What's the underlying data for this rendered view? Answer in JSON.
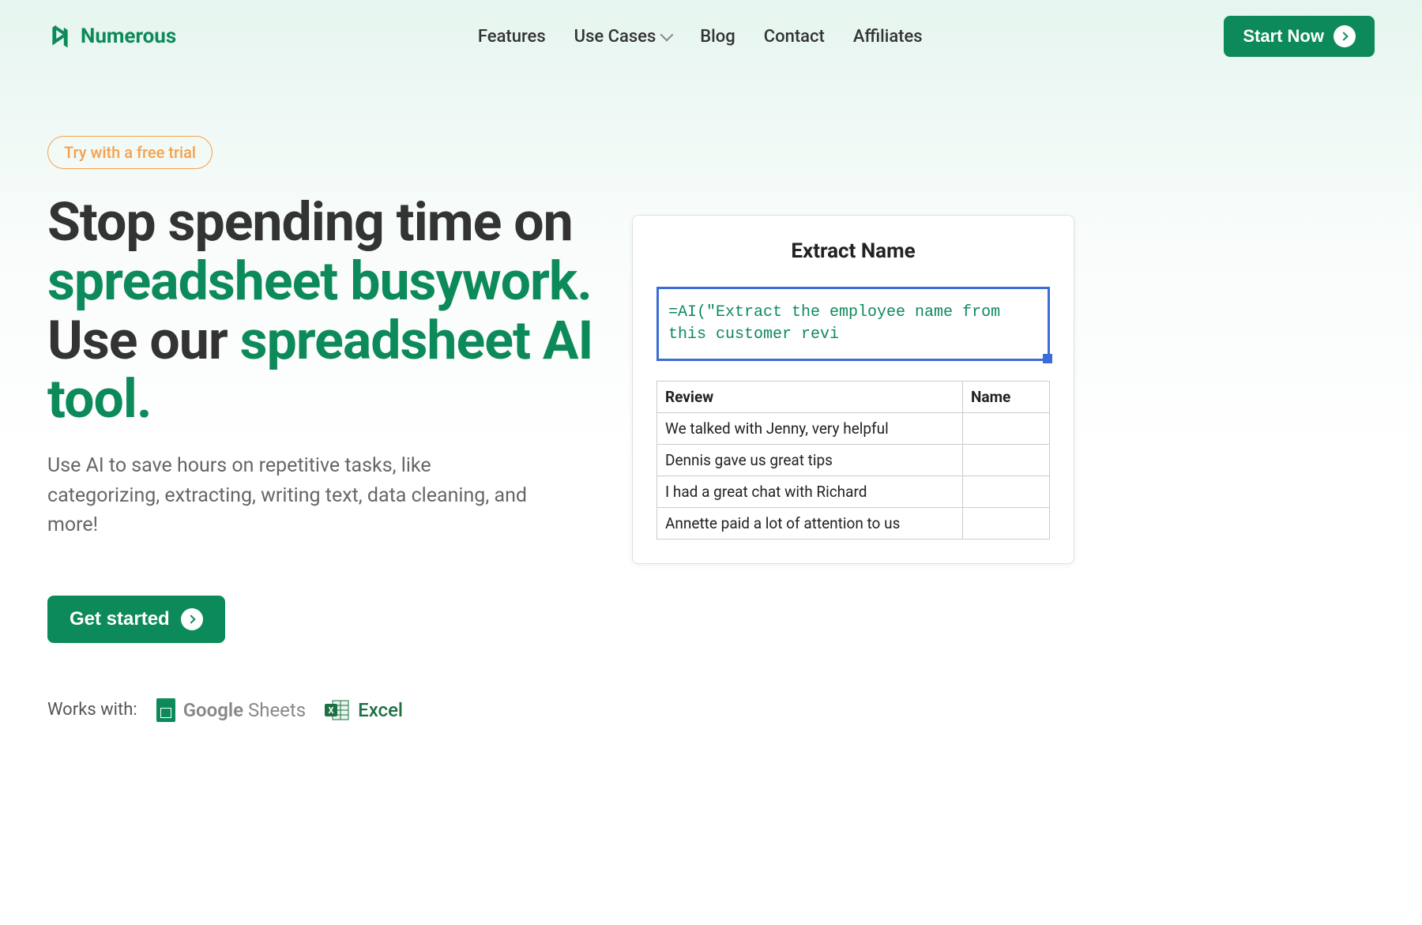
{
  "header": {
    "brand": "Numerous",
    "nav": {
      "features": "Features",
      "usecases": "Use Cases",
      "blog": "Blog",
      "contact": "Contact",
      "affiliates": "Affiliates"
    },
    "cta": "Start Now"
  },
  "hero": {
    "trial_badge": "Try with a free trial",
    "headline_part1": "Stop spending time on ",
    "headline_green1": "spreadsheet busywork. ",
    "headline_part2": "Use our ",
    "headline_green2": "spreadsheet AI tool.",
    "subheadline": "Use AI to save hours on repetitive tasks, like categorizing, extracting, writing text, data cleaning, and more!",
    "get_started": "Get started",
    "works_with_label": "Works with:",
    "partners": {
      "google_sheets_1": "Google",
      "google_sheets_2": " Sheets",
      "excel": "Excel"
    }
  },
  "demo": {
    "title": "Extract Name",
    "formula": "=AI(\"Extract the employee name from this customer revi",
    "table": {
      "headers": {
        "review": "Review",
        "name": "Name"
      },
      "rows": [
        {
          "review": "We talked with Jenny, very helpful",
          "name": ""
        },
        {
          "review": "Dennis gave us great tips",
          "name": ""
        },
        {
          "review": "I had a great chat with Richard",
          "name": ""
        },
        {
          "review": "Annette paid a lot of attention to us",
          "name": ""
        }
      ]
    }
  }
}
